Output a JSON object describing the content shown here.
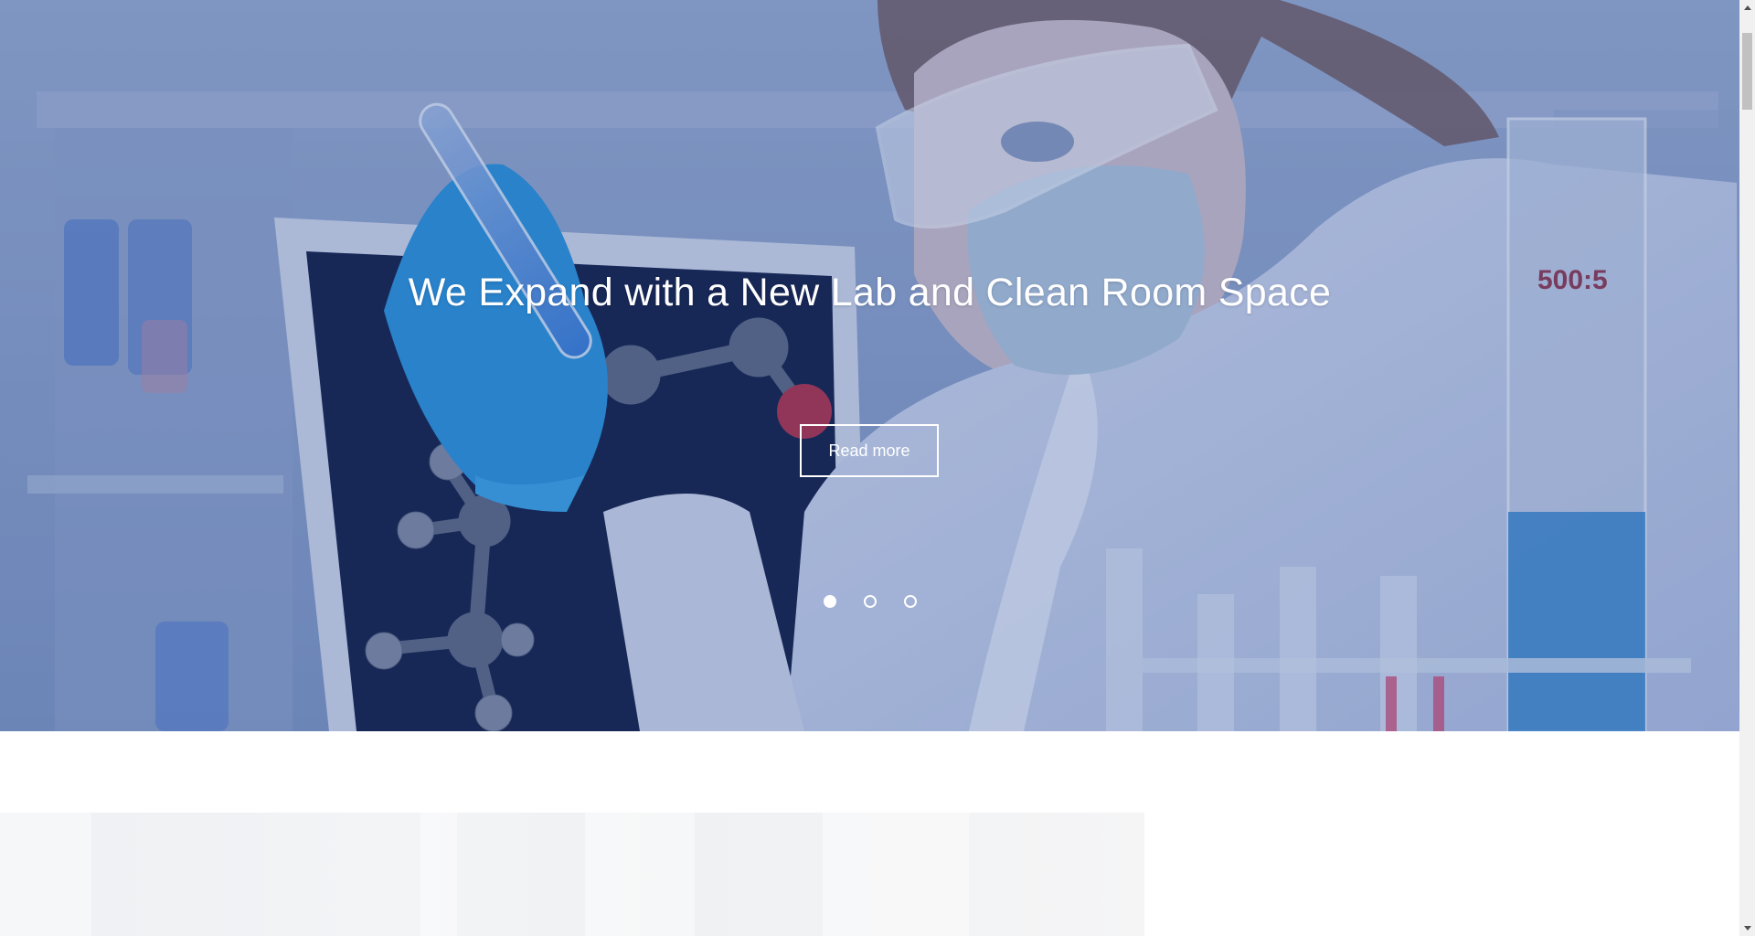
{
  "hero": {
    "title": "We Expand with a New Lab and Clean Room Space",
    "button_label": "Read more",
    "slides": {
      "count": 3,
      "active": 1
    }
  },
  "photo_label": "500:5"
}
